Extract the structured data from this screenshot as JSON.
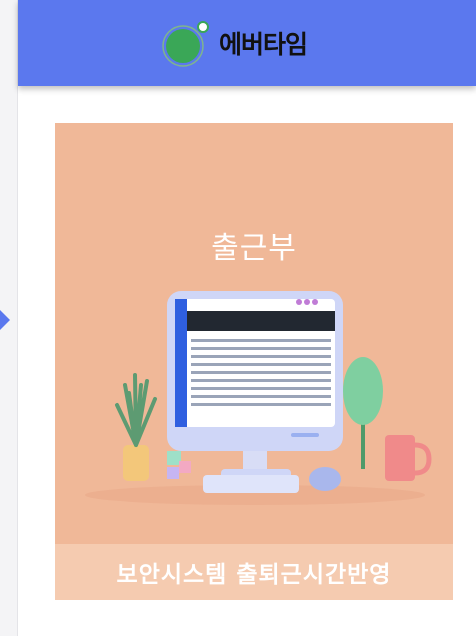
{
  "header": {
    "brand_name": "에버타임",
    "logo_icon": "logo-circle-icon"
  },
  "card": {
    "title": "출근부",
    "caption": "보안시스템 출퇴근시간반영",
    "accent_color": "#f0b898"
  },
  "colors": {
    "header_bg": "#5b78ee",
    "rail_arrow": "#5b78ee"
  }
}
